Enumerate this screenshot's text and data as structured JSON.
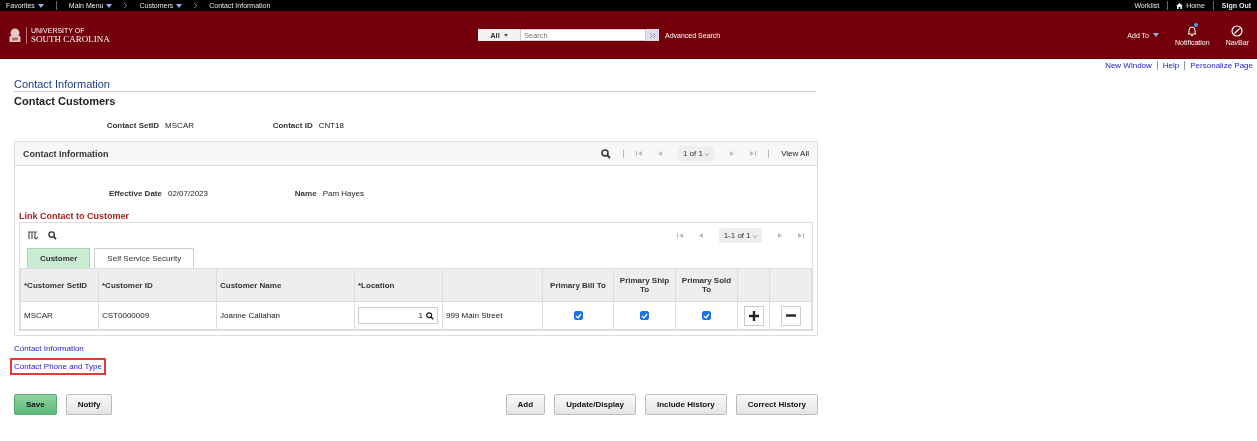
{
  "nav_bar": {
    "items": [
      {
        "label": "Favorites",
        "kind": "menu"
      },
      {
        "label": "Main Menu",
        "kind": "menu"
      },
      {
        "label": "Customers",
        "kind": "crumb-menu"
      },
      {
        "label": "Contact Information",
        "kind": "crumb"
      }
    ],
    "right": [
      {
        "label": "Worklist",
        "kind": "link"
      },
      {
        "label": "Home",
        "kind": "home"
      },
      {
        "label": "Sign Out",
        "kind": "strong"
      }
    ]
  },
  "banner": {
    "logo_small": "UNIVERSITY OF",
    "logo_large": "SOUTH CAROLINA",
    "search": {
      "scope": "All",
      "placeholder": "Search"
    },
    "advanced_search": "Advanced Search",
    "add_to": "Add To",
    "notification": {
      "label": "Notification",
      "unread": true
    },
    "navbar": "NavBar"
  },
  "page_links": [
    "New Window",
    "Help",
    "Personalize Page"
  ],
  "breadcrumb_title": "Contact Information",
  "heading": "Contact Customers",
  "key_fields": [
    {
      "label": "Contact SetID",
      "value": "MSCAR"
    },
    {
      "label": "Contact ID",
      "value": "CNT18"
    }
  ],
  "panel": {
    "title": "Contact Information",
    "pager": "1 of 1",
    "view_all": "View All",
    "fields": [
      {
        "label": "Effective Date",
        "value": "02/07/2023"
      },
      {
        "label": "Name",
        "value": "Pam Hayes"
      }
    ],
    "grid": {
      "title": "Link Contact to Customer",
      "pager": "1-1 of 1",
      "tabs": [
        {
          "label": "Customer",
          "selected": true
        },
        {
          "label": "Self Service Security",
          "selected": false
        }
      ],
      "columns": [
        "*Customer SetID",
        "*Customer ID",
        "Customer Name",
        "*Location",
        "Primary Bill To",
        "Primary Ship To",
        "Primary Sold To"
      ],
      "rows": [
        {
          "setid": "MSCAR",
          "customer_id": "CST0000009",
          "customer_name": "Joanne Callahan",
          "location": "1",
          "address": "999 Main Street",
          "bill_to": true,
          "ship_to": true,
          "sold_to": true
        }
      ]
    }
  },
  "links": [
    {
      "label": "Contact Information",
      "highlighted": false
    },
    {
      "label": "Contact Phone and Type",
      "highlighted": true
    }
  ],
  "buttons_left": [
    {
      "label": "Save",
      "primary": true
    },
    {
      "label": "Notify",
      "primary": false
    }
  ],
  "buttons_right": [
    "Add",
    "Update/Display",
    "Include History",
    "Correct History"
  ]
}
